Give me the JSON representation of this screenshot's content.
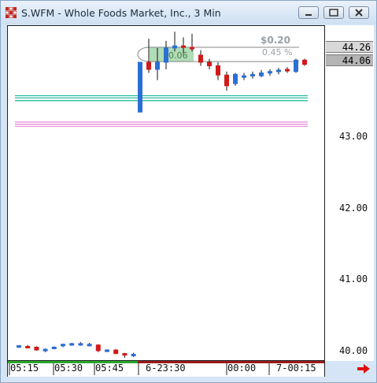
{
  "window": {
    "title": "S.WFM - Whole Foods Market, Inc., 3 Min"
  },
  "chart": {
    "y_min": 39.8,
    "y_max": 44.5,
    "price_levels": [
      {
        "label": "43.00",
        "value": 43.0
      },
      {
        "label": "42.00",
        "value": 42.0
      },
      {
        "label": "41.00",
        "value": 41.0
      },
      {
        "label": "40.00",
        "value": 40.0
      }
    ],
    "price_box_high": {
      "label": "44.26",
      "value": 44.26
    },
    "price_box_last": {
      "label": "44.06",
      "value": 44.06
    },
    "measure": {
      "delta_amount": "$0.20",
      "delta_percent": "0.45 %",
      "start_label": "-0.06"
    },
    "time_labels": [
      {
        "label": "05:15"
      },
      {
        "label": "05:30"
      },
      {
        "label": "05:45"
      },
      {
        "label": "6-23:30"
      },
      {
        "label": "00:00"
      },
      {
        "label": "7-00:15"
      }
    ]
  },
  "chart_data": {
    "type": "candlestick",
    "title": "S.WFM - Whole Foods Market, Inc., 3 Min",
    "ylim": [
      39.8,
      44.5
    ],
    "series": [
      {
        "name": "session-1",
        "values": [
          {
            "o": 40.06,
            "h": 40.08,
            "l": 40.04,
            "c": 40.07,
            "dir": "up"
          },
          {
            "o": 40.06,
            "h": 40.08,
            "l": 40.04,
            "c": 40.05,
            "dir": "down"
          },
          {
            "o": 40.05,
            "h": 40.06,
            "l": 40.0,
            "c": 40.01,
            "dir": "down"
          },
          {
            "o": 40.0,
            "h": 40.03,
            "l": 39.98,
            "c": 40.02,
            "dir": "up"
          },
          {
            "o": 40.03,
            "h": 40.06,
            "l": 40.02,
            "c": 40.05,
            "dir": "up"
          },
          {
            "o": 40.07,
            "h": 40.1,
            "l": 40.05,
            "c": 40.09,
            "dir": "up"
          },
          {
            "o": 40.09,
            "h": 40.11,
            "l": 40.07,
            "c": 40.1,
            "dir": "up"
          },
          {
            "o": 40.1,
            "h": 40.12,
            "l": 40.07,
            "c": 40.09,
            "dir": "up"
          },
          {
            "o": 40.09,
            "h": 40.11,
            "l": 40.06,
            "c": 40.08,
            "dir": "up"
          },
          {
            "o": 40.08,
            "h": 40.09,
            "l": 39.98,
            "c": 40.0,
            "dir": "down"
          },
          {
            "o": 40.0,
            "h": 40.02,
            "l": 39.98,
            "c": 40.01,
            "dir": "up"
          },
          {
            "o": 40.01,
            "h": 40.02,
            "l": 39.95,
            "c": 39.96,
            "dir": "down"
          },
          {
            "o": 39.96,
            "h": 39.97,
            "l": 39.9,
            "c": 39.94,
            "dir": "down"
          },
          {
            "o": 39.94,
            "h": 39.97,
            "l": 39.91,
            "c": 39.95,
            "dir": "up"
          }
        ]
      },
      {
        "name": "session-2",
        "values": [
          {
            "o": 43.35,
            "h": 44.05,
            "l": 43.35,
            "c": 44.05,
            "dir": "up"
          },
          {
            "o": 44.05,
            "h": 44.38,
            "l": 43.9,
            "c": 43.95,
            "dir": "down"
          },
          {
            "o": 43.95,
            "h": 44.25,
            "l": 43.8,
            "c": 44.05,
            "dir": "up"
          },
          {
            "o": 44.05,
            "h": 44.35,
            "l": 43.95,
            "c": 44.25,
            "dir": "up"
          },
          {
            "o": 44.25,
            "h": 44.48,
            "l": 44.2,
            "c": 44.28,
            "dir": "up"
          },
          {
            "o": 44.28,
            "h": 44.4,
            "l": 44.18,
            "c": 44.26,
            "dir": "down"
          },
          {
            "o": 44.26,
            "h": 44.45,
            "l": 44.2,
            "c": 44.25,
            "dir": "down"
          },
          {
            "o": 44.15,
            "h": 44.22,
            "l": 44.0,
            "c": 44.05,
            "dir": "down"
          },
          {
            "o": 44.05,
            "h": 44.1,
            "l": 43.95,
            "c": 44.0,
            "dir": "down"
          },
          {
            "o": 44.0,
            "h": 44.05,
            "l": 43.8,
            "c": 43.87,
            "dir": "down"
          },
          {
            "o": 43.87,
            "h": 43.92,
            "l": 43.65,
            "c": 43.72,
            "dir": "down"
          },
          {
            "o": 43.75,
            "h": 43.9,
            "l": 43.72,
            "c": 43.88,
            "dir": "up"
          },
          {
            "o": 43.85,
            "h": 43.9,
            "l": 43.8,
            "c": 43.86,
            "dir": "up"
          },
          {
            "o": 43.86,
            "h": 43.92,
            "l": 43.82,
            "c": 43.88,
            "dir": "up"
          },
          {
            "o": 43.86,
            "h": 43.94,
            "l": 43.84,
            "c": 43.9,
            "dir": "up"
          },
          {
            "o": 43.9,
            "h": 43.95,
            "l": 43.86,
            "c": 43.92,
            "dir": "up"
          },
          {
            "o": 43.92,
            "h": 43.97,
            "l": 43.88,
            "c": 43.94,
            "dir": "up"
          },
          {
            "o": 43.95,
            "h": 43.98,
            "l": 43.9,
            "c": 43.93,
            "dir": "down"
          },
          {
            "o": 43.92,
            "h": 44.1,
            "l": 43.9,
            "c": 44.08,
            "dir": "up"
          },
          {
            "o": 44.08,
            "h": 44.1,
            "l": 44.0,
            "c": 44.02,
            "dir": "down"
          }
        ]
      }
    ],
    "bands": [
      {
        "color": "#17b59a",
        "values": [
          43.58,
          43.55,
          43.51
        ]
      },
      {
        "color": "#e68ad4",
        "values": [
          43.21,
          43.18,
          43.15
        ]
      }
    ],
    "colors": {
      "up": "#2b6fd6",
      "down": "#d21a1a"
    }
  }
}
